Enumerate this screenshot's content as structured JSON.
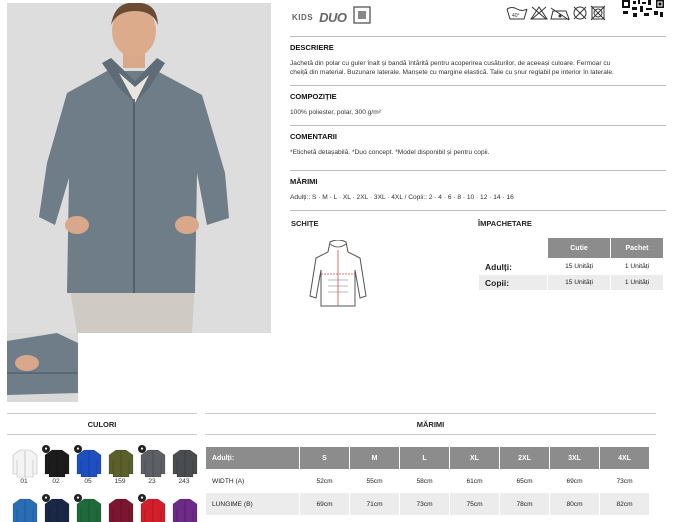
{
  "badges": {
    "kids": "KIDS",
    "duo": "DUO"
  },
  "care_symbols": [
    "wash-40-icon",
    "no-bleach-icon",
    "iron-low-icon",
    "no-dry-clean-icon",
    "no-tumble-dry-icon"
  ],
  "care_wash_temp": "40°",
  "description": {
    "title": "DESCRIERE",
    "line1": "Jachetă din polar cu guler înalt și bandă întărită pentru acoperirea cusăturilor, de aceeași culoare. Fermoar cu",
    "line2": "cheiță din material. Buzunare laterale. Manșete cu margine elastică. Talie cu șnur reglabil pe interior în laterale."
  },
  "composition": {
    "title": "COMPOZIȚIE",
    "text": "100% poliester, polar, 300 g/m²"
  },
  "comments": {
    "title": "COMENTARII",
    "text": "*Etichetă detașabilă. *Duo concept. *Model disponibil și pentru copii."
  },
  "sizes_info": {
    "title": "MĂRIMI",
    "text": "Adulți:: S · M · L · XL · 2XL · 3XL · 4XL / Copii:: 2 · 4 · 6 · 8 · 10 · 12 · 14 · 16"
  },
  "sketches_title": "SCHIȚE",
  "packing": {
    "title": "ÎMPACHETARE",
    "headers": [
      "Cutie",
      "Pachet"
    ],
    "rows": [
      {
        "label": "Adulți:",
        "cutie": "15 Unități",
        "pachet": "1 Unități"
      },
      {
        "label": "Copii:",
        "cutie": "15 Unități",
        "pachet": "1 Unități"
      }
    ]
  },
  "colors": {
    "title": "CULORI",
    "row1": [
      {
        "code": "01",
        "hex": "#f4f4f4",
        "kids": false
      },
      {
        "code": "02",
        "hex": "#1c1c1c",
        "kids": true
      },
      {
        "code": "05",
        "hex": "#1e4fc0",
        "kids": true
      },
      {
        "code": "159",
        "hex": "#5b5f2c",
        "kids": false
      },
      {
        "code": "23",
        "hex": "#5c5f63",
        "kids": true
      },
      {
        "code": "243",
        "hex": "#4a4d50",
        "kids": false
      }
    ],
    "row2": [
      {
        "hex": "#2a6db5",
        "kids": false
      },
      {
        "hex": "#1a2846",
        "kids": true
      },
      {
        "hex": "#1f6a3a",
        "kids": true
      },
      {
        "hex": "#7b1530",
        "kids": false
      },
      {
        "hex": "#d21f2b",
        "kids": true
      },
      {
        "hex": "#6d2a86",
        "kids": false
      }
    ]
  },
  "size_table": {
    "title": "MĂRIMI",
    "header": "Adulți:",
    "columns": [
      "S",
      "M",
      "L",
      "XL",
      "2XL",
      "3XL",
      "4XL"
    ],
    "rows": [
      {
        "label": "WIDTH (A)",
        "values": [
          "52cm",
          "55cm",
          "58cm",
          "61cm",
          "65cm",
          "69cm",
          "73cm"
        ]
      },
      {
        "label": "LUNGIME (B)",
        "values": [
          "69cm",
          "71cm",
          "73cm",
          "75cm",
          "78cm",
          "80cm",
          "82cm"
        ]
      }
    ]
  }
}
